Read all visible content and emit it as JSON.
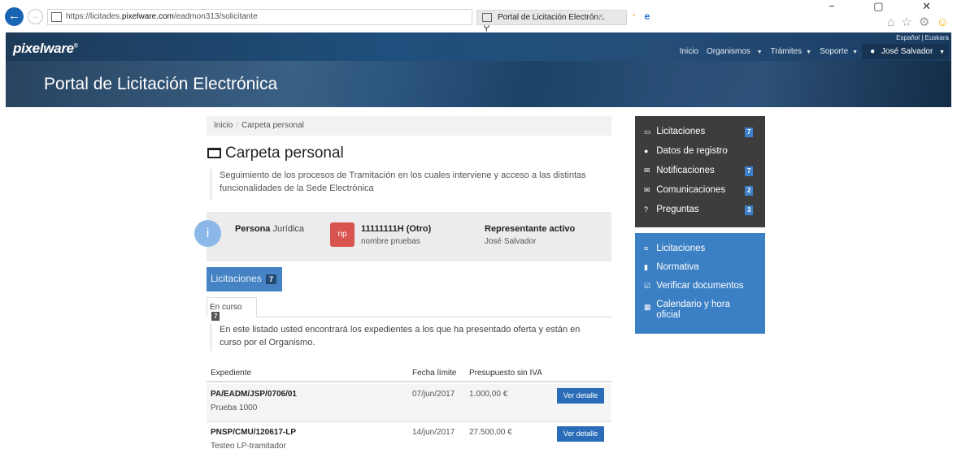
{
  "browser": {
    "url_prefix": "https://licitades.",
    "url_domain": "pixelware.com",
    "url_path": "/eadmon313/solicitante",
    "addr_tools": "⚲ ▾ 🔒 ↻",
    "tab_title": "Portal de Licitación Electrón...",
    "tab_close": "×",
    "win_controls": "−  ▢  ✕",
    "back": "←",
    "forward": "→",
    "home_icons": "⌂ ☆ ⚙",
    "smiley": "☺"
  },
  "header": {
    "brand": "pixelware",
    "brand_mark": "®",
    "lang_es": "Español",
    "lang_sep": "|",
    "lang_eu": "Euskara",
    "nav": {
      "inicio": "Inicio",
      "organismos": "Organismos",
      "tramites": "Trámites",
      "soporte": "Soporte",
      "user": "José Salvador"
    },
    "portal_title": "Portal de Licitación Electrónica"
  },
  "breadcrumb": {
    "home": "Inicio",
    "separator": "/",
    "current": "Carpeta personal"
  },
  "page": {
    "title": "Carpeta personal",
    "description": "Seguimiento de los procesos de Tramitación en los cuales interviene y acceso a las distintas funcionalidades de la Sede Electrónica"
  },
  "info": {
    "badge": "i",
    "persona_bold": "Persona",
    "persona_type": "Jurídica",
    "avatar_initials": "np",
    "id_code": "11111111H (Otro)",
    "id_name": "nombre pruebas",
    "rep_title": "Representante activo",
    "rep_name": "José Salvador"
  },
  "tabs": {
    "main_label": "Licitaciones",
    "main_count": "7",
    "sub_label": "En curso",
    "sub_count": "7"
  },
  "list": {
    "description": "En este listado usted encontrará los expedientes a los que ha presentado oferta y están en curso por el Organismo.",
    "columns": {
      "expediente": "Expediente",
      "fecha": "Fecha límite",
      "presupuesto": "Presupuesto sin IVA"
    },
    "rows": [
      {
        "code": "PA/EADM/JSP/0706/01",
        "name": "Prueba 1000",
        "date": "07/jun/2017",
        "amount": "1.000,00 €",
        "button": "Ver detalle"
      },
      {
        "code": "PNSP/CMU/120617-LP",
        "name": "Testeo LP-tramitador",
        "date": "14/jun/2017",
        "amount": "27.500,00 €",
        "button": "Ver detalle"
      }
    ]
  },
  "side_personal": [
    {
      "label": "Licitaciones",
      "icon": "inbox-icon",
      "glyph": "▭",
      "count": "7"
    },
    {
      "label": "Datos de registro",
      "icon": "user-icon",
      "glyph": "●",
      "count": ""
    },
    {
      "label": "Notificaciones",
      "icon": "envelope-icon",
      "glyph": "✉",
      "count": "7"
    },
    {
      "label": "Comunicaciones",
      "icon": "envelope-open-icon",
      "glyph": "✉",
      "count": "2"
    },
    {
      "label": "Preguntas",
      "icon": "question-icon",
      "glyph": "?",
      "count": "3"
    }
  ],
  "side_public": [
    {
      "label": "Licitaciones",
      "icon": "list-icon",
      "glyph": "≡"
    },
    {
      "label": "Normativa",
      "icon": "book-icon",
      "glyph": "▮"
    },
    {
      "label": "Verificar documentos",
      "icon": "check-square-icon",
      "glyph": "☑"
    },
    {
      "label": "Calendario y hora",
      "label2": "oficial",
      "icon": "calendar-icon",
      "glyph": "▦"
    }
  ],
  "colors": {
    "header_bg": "#1f4f7c",
    "primary_blue": "#3b7fc4",
    "button_blue": "#2a6cb8",
    "dark_panel": "#3d3d3d",
    "avatar_red": "#d9534f"
  }
}
